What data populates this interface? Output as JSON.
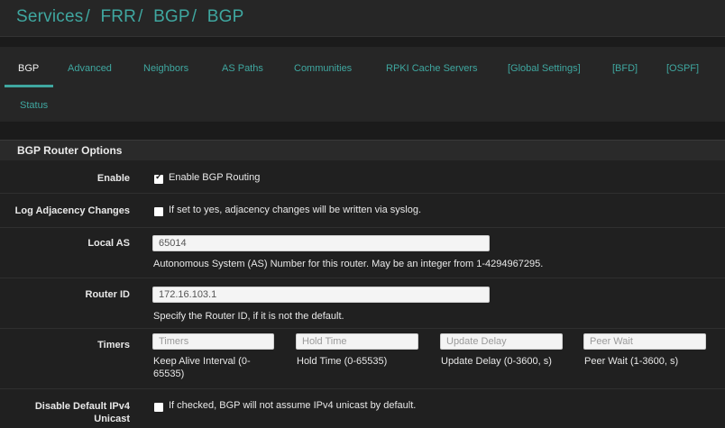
{
  "breadcrumb": [
    "Services",
    "FRR",
    "BGP",
    "BGP"
  ],
  "breadcrumb_separator": "/",
  "tabs": [
    "BGP",
    "Advanced",
    "Neighbors",
    "AS Paths",
    "Communities",
    "RPKI Cache Servers",
    "[Global Settings]",
    "[BFD]",
    "[OSPF]",
    "Status"
  ],
  "active_tab": "BGP",
  "panel": {
    "title": "BGP Router Options",
    "enable": {
      "label": "Enable",
      "checkbox_label": "Enable BGP Routing",
      "checked": true
    },
    "log_adjacency": {
      "label": "Log Adjacency Changes",
      "checkbox_label": "If set to yes, adjacency changes will be written via syslog.",
      "checked": false
    },
    "local_as": {
      "label": "Local AS",
      "value": "65014",
      "help": "Autonomous System (AS) Number for this router. May be an integer from 1-4294967295."
    },
    "router_id": {
      "label": "Router ID",
      "value": "172.16.103.1",
      "help": "Specify the Router ID, if it is not the default."
    },
    "timers": {
      "label": "Timers",
      "fields": [
        {
          "placeholder": "Timers",
          "help": "Keep Alive Interval (0-65535)"
        },
        {
          "placeholder": "Hold Time",
          "help": "Hold Time (0-65535)"
        },
        {
          "placeholder": "Update Delay",
          "help": "Update Delay (0-3600, s)"
        },
        {
          "placeholder": "Peer Wait",
          "help": "Peer Wait (1-3600, s)"
        }
      ]
    },
    "disable_ipv4": {
      "label": "Disable Default IPv4 Unicast",
      "checkbox_label": "If checked, BGP will not assume IPv4 unicast by default.",
      "checked": false
    }
  },
  "colors": {
    "accent": "#3fa7a0",
    "background": "#1b1b1b",
    "panel": "#262626"
  }
}
